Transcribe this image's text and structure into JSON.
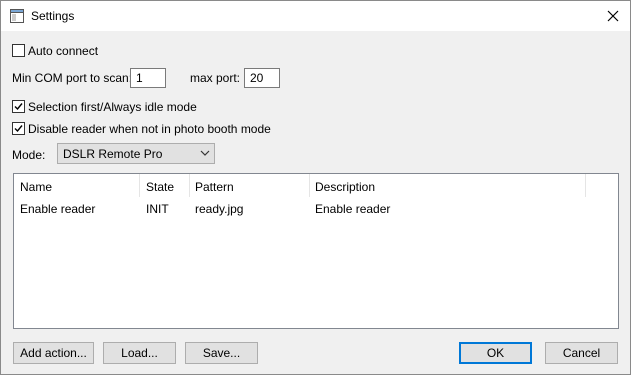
{
  "window": {
    "title": "Settings",
    "close_icon": "close-icon"
  },
  "options": {
    "auto_connect": {
      "label": "Auto connect",
      "checked": false
    },
    "min_com_label": "Min COM port to scan:",
    "min_com_value": "1",
    "max_port_label": "max port:",
    "max_port_value": "20",
    "selection_first": {
      "label": "Selection first/Always idle mode",
      "checked": true
    },
    "disable_reader": {
      "label": "Disable reader when not in photo booth mode",
      "checked": true
    },
    "mode_label": "Mode:",
    "mode_value": "DSLR Remote Pro"
  },
  "table": {
    "columns": [
      "Name",
      "State",
      "Pattern",
      "Description"
    ],
    "rows": [
      {
        "name": "Enable reader",
        "state": "INIT",
        "pattern": "ready.jpg",
        "description": "Enable reader"
      }
    ]
  },
  "buttons": {
    "add_action": "Add action...",
    "load": "Load...",
    "save": "Save...",
    "ok": "OK",
    "cancel": "Cancel"
  }
}
